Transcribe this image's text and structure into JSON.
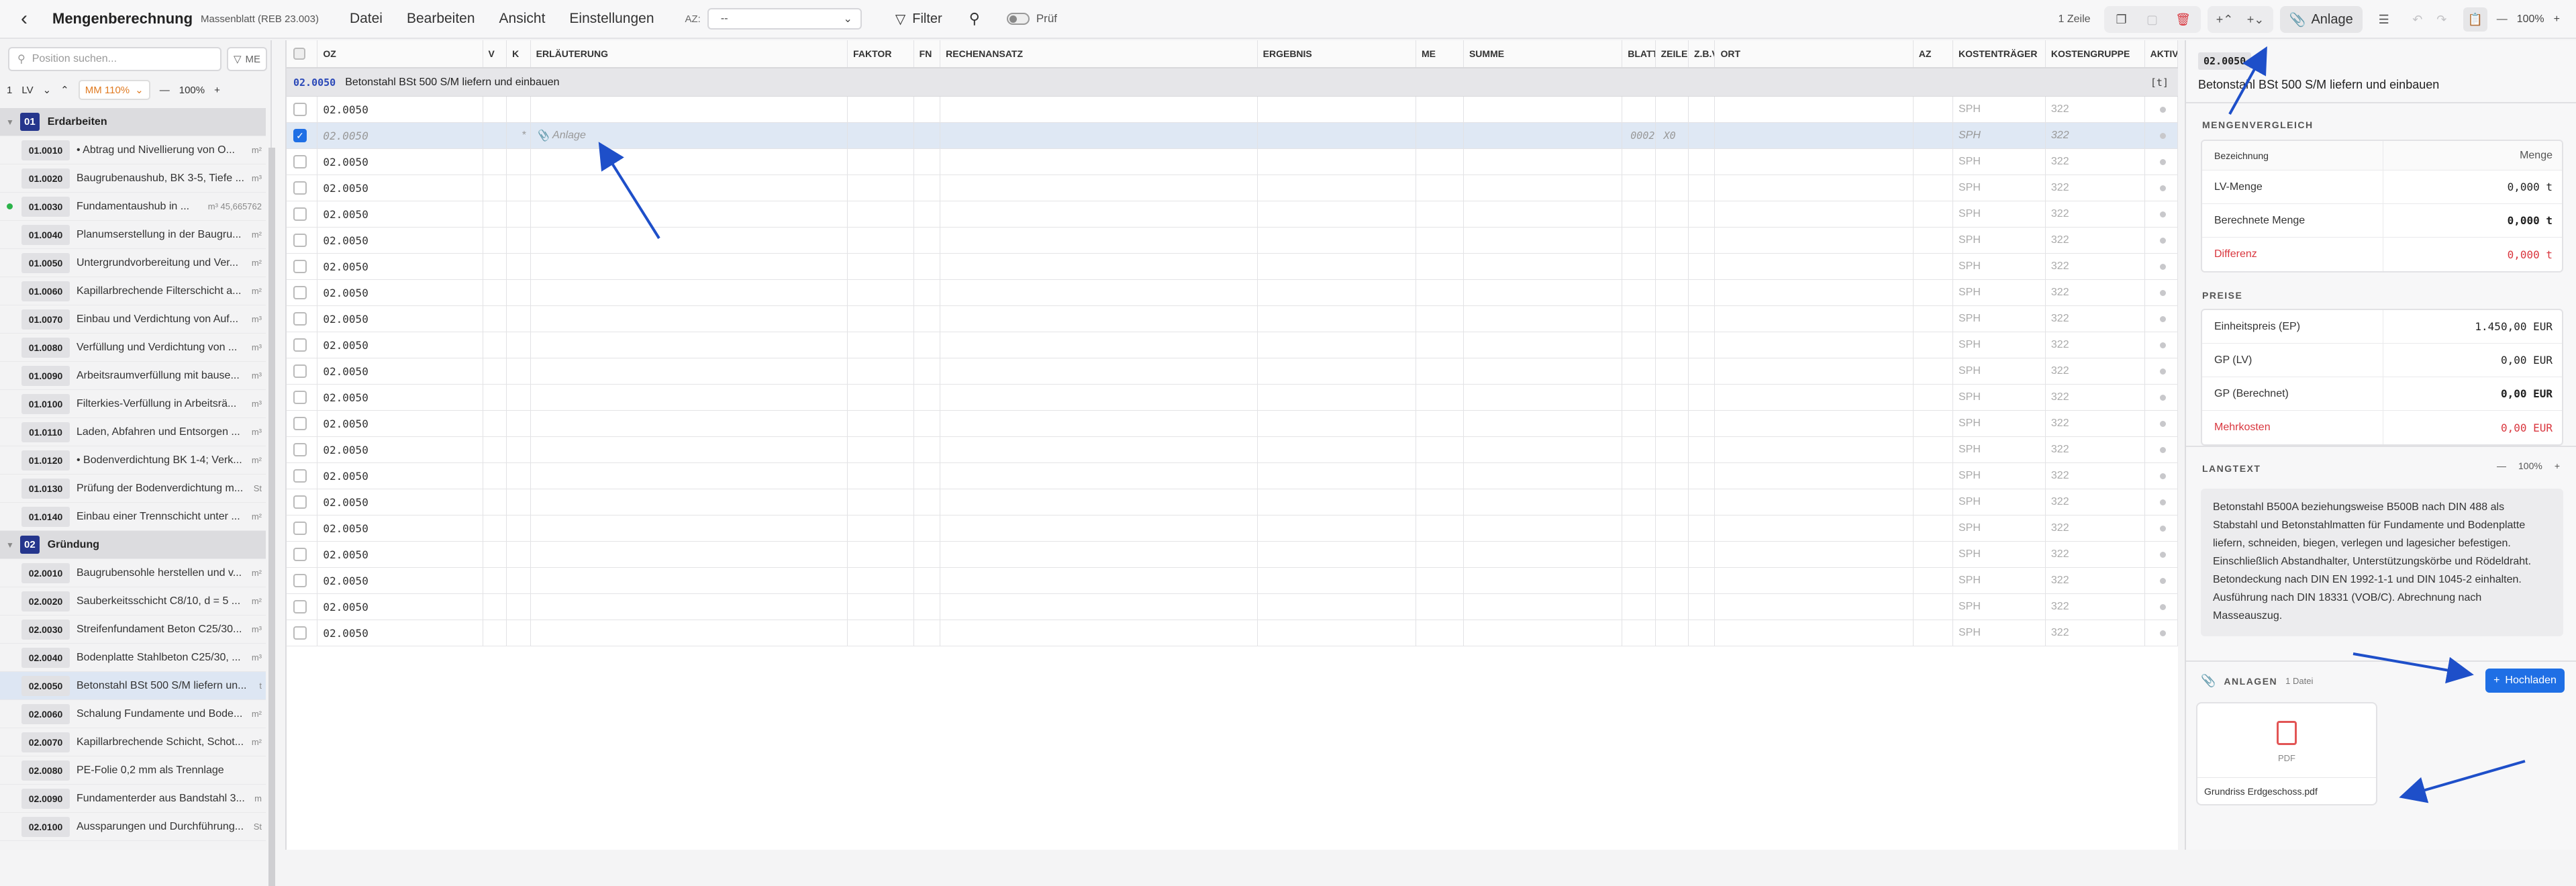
{
  "topbar": {
    "title": "Mengenberechnung",
    "subtitle": "Massenblatt (REB 23.003)",
    "menu": [
      "Datei",
      "Bearbeiten",
      "Ansicht",
      "Einstellungen"
    ],
    "az_label": "AZ:",
    "az_value": "--",
    "filter_label": "Filter",
    "pruef_label": "Prüf",
    "row_count": "1 Zeile",
    "anlage_label": "Anlage",
    "zoom": "100%"
  },
  "sidebar": {
    "search_placeholder": "Position suchen...",
    "me_label": "ME",
    "level": "1",
    "lv_label": "LV",
    "mm_label": "MM 110%",
    "zoom": "100%",
    "groups": [
      {
        "num": "01",
        "label": "Erdarbeiten",
        "items": [
          {
            "oz": "01.0010",
            "text": "• Abtrag und Nivellierung von O...",
            "unit": "m²"
          },
          {
            "oz": "01.0020",
            "text": "Baugrubenaushub, BK 3-5, Tiefe ...",
            "unit": "m³"
          },
          {
            "oz": "01.0030",
            "text": "Fundamentaushub in ...",
            "unit": "m³ 45,665762"
          },
          {
            "oz": "01.0040",
            "text": "Planumserstellung in der Baugru...",
            "unit": "m²"
          },
          {
            "oz": "01.0050",
            "text": "Untergrundvorbereitung und Ver...",
            "unit": "m²"
          },
          {
            "oz": "01.0060",
            "text": "Kapillarbrechende Filterschicht a...",
            "unit": "m²"
          },
          {
            "oz": "01.0070",
            "text": "Einbau und Verdichtung von Auf...",
            "unit": "m³"
          },
          {
            "oz": "01.0080",
            "text": "Verfüllung und Verdichtung von ...",
            "unit": "m³"
          },
          {
            "oz": "01.0090",
            "text": "Arbeitsraumverfüllung mit bause...",
            "unit": "m³"
          },
          {
            "oz": "01.0100",
            "text": "Filterkies-Verfüllung in Arbeitsrä...",
            "unit": "m³"
          },
          {
            "oz": "01.0110",
            "text": "Laden, Abfahren und Entsorgen ...",
            "unit": "m³"
          },
          {
            "oz": "01.0120",
            "text": "• Bodenverdichtung BK 1-4; Verk...",
            "unit": "m²"
          },
          {
            "oz": "01.0130",
            "text": "Prüfung der Bodenverdichtung m...",
            "unit": "St"
          },
          {
            "oz": "01.0140",
            "text": "Einbau einer Trennschicht unter ...",
            "unit": "m²"
          }
        ]
      },
      {
        "num": "02",
        "label": "Gründung",
        "items": [
          {
            "oz": "02.0010",
            "text": "Baugrubensohle herstellen und v...",
            "unit": "m²"
          },
          {
            "oz": "02.0020",
            "text": "Sauberkeitsschicht C8/10, d = 5 ...",
            "unit": "m²"
          },
          {
            "oz": "02.0030",
            "text": "Streifenfundament Beton C25/30...",
            "unit": "m³"
          },
          {
            "oz": "02.0040",
            "text": "Bodenplatte Stahlbeton C25/30, ...",
            "unit": "m³"
          },
          {
            "oz": "02.0050",
            "text": "Betonstahl BSt 500 S/M liefern un...",
            "unit": "t"
          },
          {
            "oz": "02.0060",
            "text": "Schalung Fundamente und Bode...",
            "unit": "m²"
          },
          {
            "oz": "02.0070",
            "text": "Kapillarbrechende Schicht, Schot...",
            "unit": "m²"
          },
          {
            "oz": "02.0080",
            "text": "PE-Folie 0,2 mm als Trennlage",
            "unit": ""
          },
          {
            "oz": "02.0090",
            "text": "Fundamenterder aus Bandstahl 3...",
            "unit": "m"
          },
          {
            "oz": "02.0100",
            "text": "Aussparungen und Durchführung...",
            "unit": "St"
          }
        ]
      }
    ]
  },
  "grid": {
    "columns": [
      "OZ",
      "V",
      "K",
      "ERLÄUTERUNG",
      "FAKTOR",
      "FN",
      "RECHENANSATZ",
      "ERGEBNIS",
      "ME",
      "SUMME",
      "BLATT",
      "ZEILE",
      "Z.B.V",
      "ORT",
      "AZ",
      "KOSTENTRÄGER",
      "KOSTENGRUPPE",
      "AKTIV"
    ],
    "section": {
      "oz": "02.0050",
      "title": "Betonstahl BSt 500 S/M liefern und einbauen",
      "unit": "[t]"
    },
    "selected_row": {
      "oz": "02.0050",
      "k": "*",
      "erl": "Anlage",
      "blatt": "0002",
      "zeile": "X0",
      "kt": "SPH",
      "kg": "322"
    },
    "row_oz": "02.0050",
    "row_kt": "SPH",
    "row_kg": "322",
    "row_count": 21
  },
  "panel": {
    "oz": "02.0050",
    "unit": "t",
    "title": "Betonstahl BSt 500 S/M liefern und einbauen",
    "mengen_label": "MENGENVERGLEICH",
    "mengen_hdr": [
      "Bezeichnung",
      "Menge"
    ],
    "mengen": [
      {
        "k": "LV-Menge",
        "v": "0,000 t"
      },
      {
        "k": "Berechnete Menge",
        "v": "0,000 t"
      },
      {
        "k": "Differenz",
        "v": "0,000 t"
      }
    ],
    "preise_label": "PREISE",
    "preise": [
      {
        "k": "Einheitspreis (EP)",
        "v": "1.450,00 EUR"
      },
      {
        "k": "GP (LV)",
        "v": "0,00 EUR"
      },
      {
        "k": "GP (Berechnet)",
        "v": "0,00 EUR"
      },
      {
        "k": "Mehrkosten",
        "v": "0,00 EUR"
      }
    ],
    "langtext_label": "LANGTEXT",
    "langtext_zoom": "100%",
    "langtext": "Betonstahl B500A beziehungsweise B500B nach DIN 488 als Stabstahl und Betonstahlmatten für Fundamente und Bodenplatte liefern, schneiden, biegen, verlegen und lagesicher befestigen. Einschließlich Abstandhalter, Unterstützungskörbe und Rödeldraht. Betondeckung nach DIN EN 1992-1-1 und DIN 1045-2 einhalten. Ausführung nach DIN 18331 (VOB/C). Abrechnung nach Masseauszug.",
    "anlagen_label": "ANLAGEN",
    "anlagen_count": "1 Datei",
    "upload_label": "Hochladen",
    "file_type": "PDF",
    "file_name": "Grundriss Erdgeschoss.pdf"
  },
  "colors": {
    "accent": "#1f6fe5",
    "group_badge": "#25368d",
    "danger": "#d9363e",
    "arrow": "#1e4fc9"
  }
}
